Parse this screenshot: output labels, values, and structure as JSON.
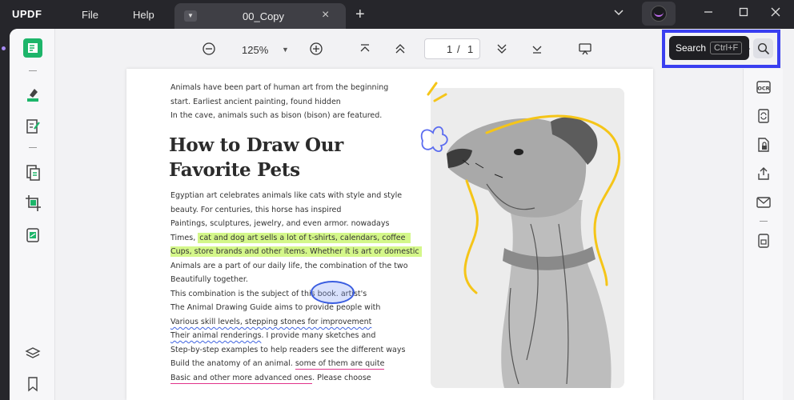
{
  "app": {
    "logo": "UPDF",
    "menu": [
      "File",
      "Help"
    ],
    "tab_title": "00_Copy",
    "tab_add": "+",
    "tab_close": "×",
    "window_controls": {
      "minimize": "—",
      "maximize": "☐",
      "close": "✕"
    }
  },
  "toolbar": {
    "zoom": "125%",
    "page_current": "1",
    "page_sep": "/",
    "page_total": "1"
  },
  "search": {
    "label": "Search",
    "shortcut": "Ctrl+F"
  },
  "document": {
    "intro_lines": [
      "Animals have been part of human art from the beginning",
      "start. Earliest ancient painting, found hidden",
      "In the cave, animals such as bison (bison) are featured."
    ],
    "heading_lines": [
      "How to Draw Our",
      "Favorite Pets"
    ],
    "body": {
      "l1": "Egyptian art celebrates animals like cats with style and style",
      "l2": "beauty. For centuries, this horse has inspired",
      "l3": "Paintings, sculptures, jewelry, and even armor. nowadays",
      "l4_plain": "Times, ",
      "l4_hl": "cat and dog art sells a lot of t-shirts, calendars, coffee",
      "l5_hl": "Cups, store brands and other items. Whether it is art or domestic",
      "l6": "Animals are a part of our daily life, the combination of the two",
      "l7": "Beautifully together.",
      "l8_plain": "This combination is the subject of this book. ",
      "l8_circle": "artist's",
      "l9": "The Animal Drawing Guide aims to provide people with",
      "l10_wavy": "Various skill levels, stepping stones for improvement",
      "l11_plain1": "Their animal renderings",
      "l11_plain2": ". I provide many sketches and",
      "l12": "Step-by-step examples to help readers see the different ways",
      "l13_plain": "Build the anatomy of an animal. ",
      "l13_pink": "some of them are quite",
      "l14_pink": "Basic and other more advanced ones",
      "l14_plain": ". Please choose"
    }
  },
  "colors": {
    "highlight": "#d4f78a",
    "search_outline": "#3a3ff0",
    "accent_green": "#1db56a",
    "doodle_yellow": "#f5c518",
    "doodle_blue": "#5b6cf0"
  },
  "icons": {
    "left_sidebar": [
      "reader-icon",
      "highlighter-icon",
      "edit-icon",
      "organize-pages-icon",
      "crop-icon",
      "convert-icon",
      "layers-icon",
      "bookmark-icon"
    ],
    "right_sidebar": [
      "ocr-icon",
      "convert-icon",
      "protect-icon",
      "share-icon",
      "email-icon",
      "save-icon"
    ]
  }
}
